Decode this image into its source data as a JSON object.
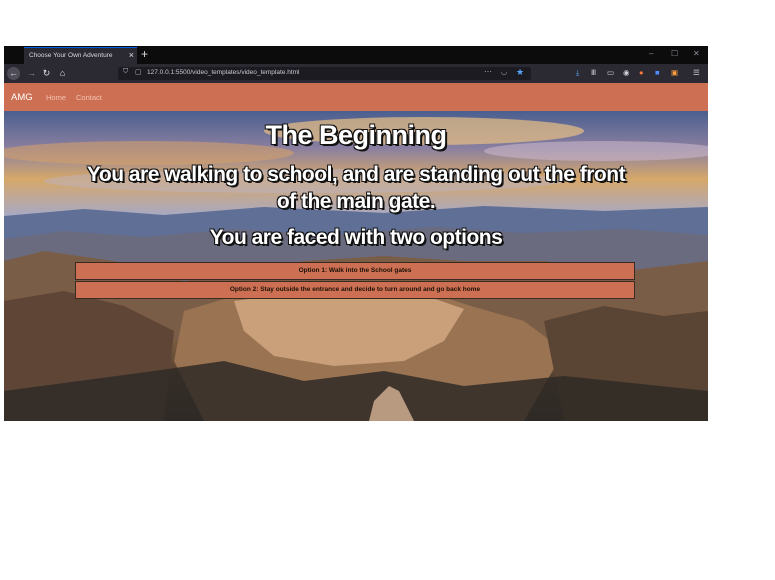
{
  "browser": {
    "tab_title": "Choose Your Own Adventure",
    "url": "127.0.0.1:5500/video_templates/video_template.html"
  },
  "site": {
    "brand": "AMG",
    "nav": [
      "Home",
      "Contact"
    ]
  },
  "story": {
    "title": "The Beginning",
    "lead": "You are walking to school, and are standing out the front of the main gate.",
    "prompt": "You are faced with two options",
    "options": [
      "Option 1: Walk into the School gates",
      "Option 2: Stay outside the entrance and decide to turn around and go back home"
    ]
  },
  "colors": {
    "accent": "#cd6f52",
    "browser_dark": "#1c1b22"
  },
  "icons": [
    "back-arrow-icon",
    "forward-arrow-icon",
    "reload-icon",
    "home-icon",
    "shield-icon",
    "lock-icon",
    "star-icon",
    "download-icon",
    "library-icon",
    "sidebar-icon",
    "account-icon",
    "menu-icon"
  ]
}
